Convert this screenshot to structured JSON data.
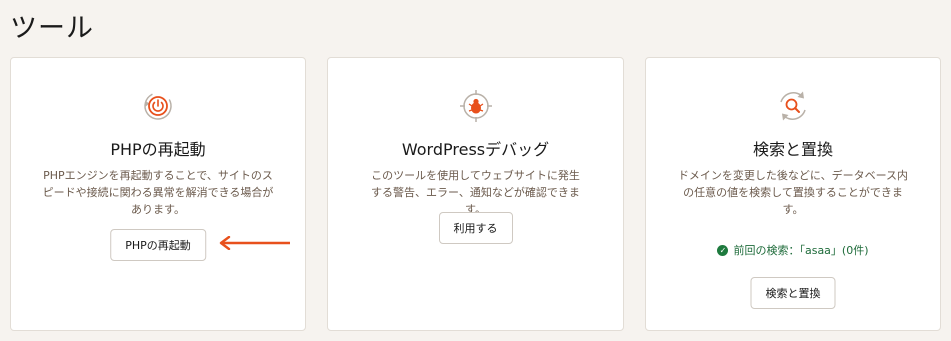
{
  "page": {
    "title": "ツール"
  },
  "cards": [
    {
      "title": "PHPの再起動",
      "description": "PHPエンジンを再起動することで、サイトのスピードや接続に関わる異常を解消できる場合があります。",
      "button_label": "PHPの再起動",
      "icon": "power-restart-icon"
    },
    {
      "title": "WordPressデバッグ",
      "description": "このツールを使用してウェブサイトに発生する警告、エラー、通知などが確認できます。",
      "button_label": "利用する",
      "icon": "bug-target-icon"
    },
    {
      "title": "検索と置換",
      "description": "ドメインを変更した後などに、データベース内の任意の値を検索して置換することができます。",
      "status": "前回の検索：「asaa」(0件)",
      "button_label": "検索と置換",
      "icon": "search-replace-icon"
    }
  ],
  "colors": {
    "accent": "#e8501c",
    "background": "#f6f3ef",
    "status_green": "#1e7a3e"
  }
}
